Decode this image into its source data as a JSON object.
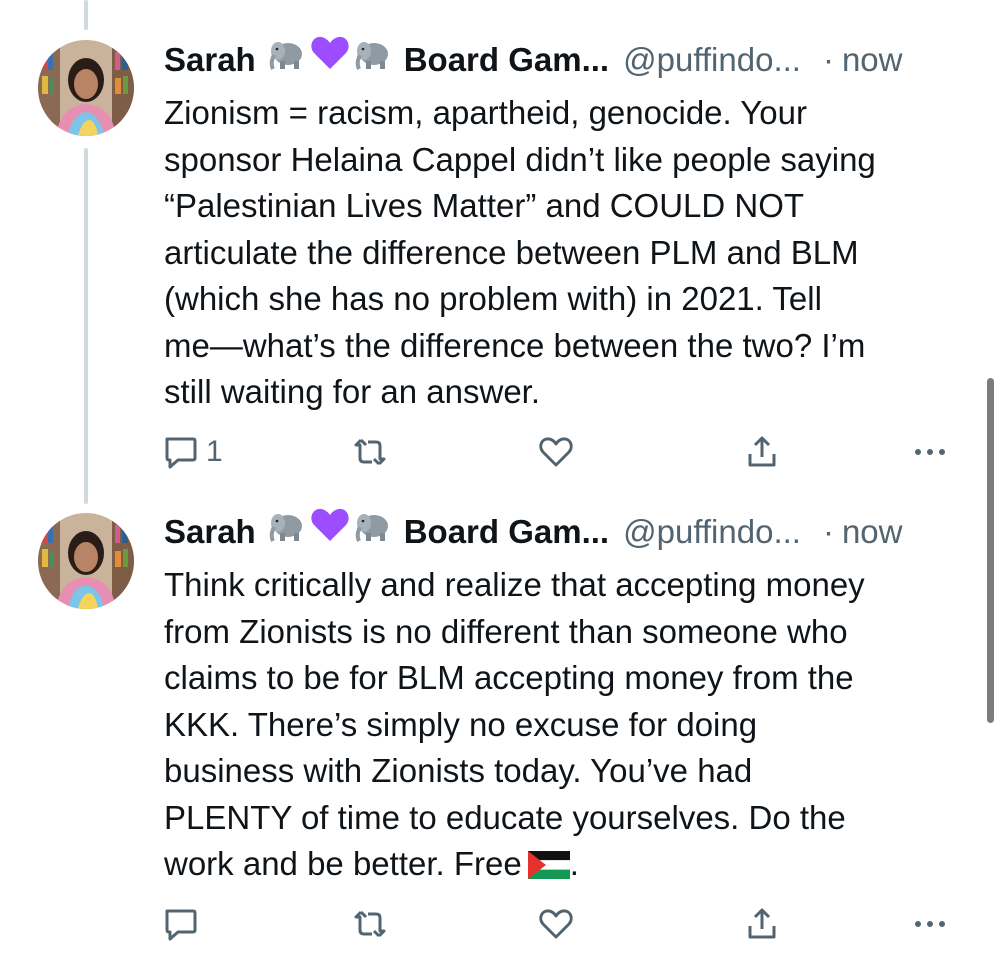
{
  "tweets": [
    {
      "author_name": "Sarah",
      "display_suffix": "Board Gam...",
      "handle": "@puffindo...",
      "separator": "·",
      "time": "now",
      "emojis": [
        "elephant-icon",
        "purple-heart-icon",
        "elephant-icon"
      ],
      "text_lines": [
        "Zionism = racism, apartheid, genocide. Your",
        "sponsor Helaina Cappel didn’t like people saying",
        "“Palestinian Lives Matter” and COULD NOT",
        "articulate the difference between PLM and BLM",
        "(which she has no problem with) in 2021. Tell",
        "me—what’s the difference between the two? I’m",
        "still waiting for an answer."
      ],
      "reply_count": "1",
      "actions": [
        "reply-icon",
        "retweet-icon",
        "like-icon",
        "share-icon",
        "more-icon"
      ]
    },
    {
      "author_name": "Sarah",
      "display_suffix": "Board Gam...",
      "handle": "@puffindo...",
      "separator": "·",
      "time": "now",
      "emojis": [
        "elephant-icon",
        "purple-heart-icon",
        "elephant-icon"
      ],
      "text_lines": [
        "Think critically and realize that accepting money",
        "from Zionists is no different than someone who",
        "claims to be for BLM accepting money from the",
        "KKK. There’s simply no excuse for doing",
        "business with Zionists today. You’ve had",
        "PLENTY of time to educate yourselves. Do the",
        "work and be better. Free"
      ],
      "text_end": ".",
      "end_emoji": "palestine-flag-icon",
      "reply_count": "",
      "actions": [
        "reply-icon",
        "retweet-icon",
        "like-icon",
        "share-icon",
        "more-icon"
      ]
    }
  ],
  "colors": {
    "text": "#0f1419",
    "secondary": "#536471",
    "thread_line": "#cfd9de",
    "purple_heart": "#9b4dff"
  }
}
